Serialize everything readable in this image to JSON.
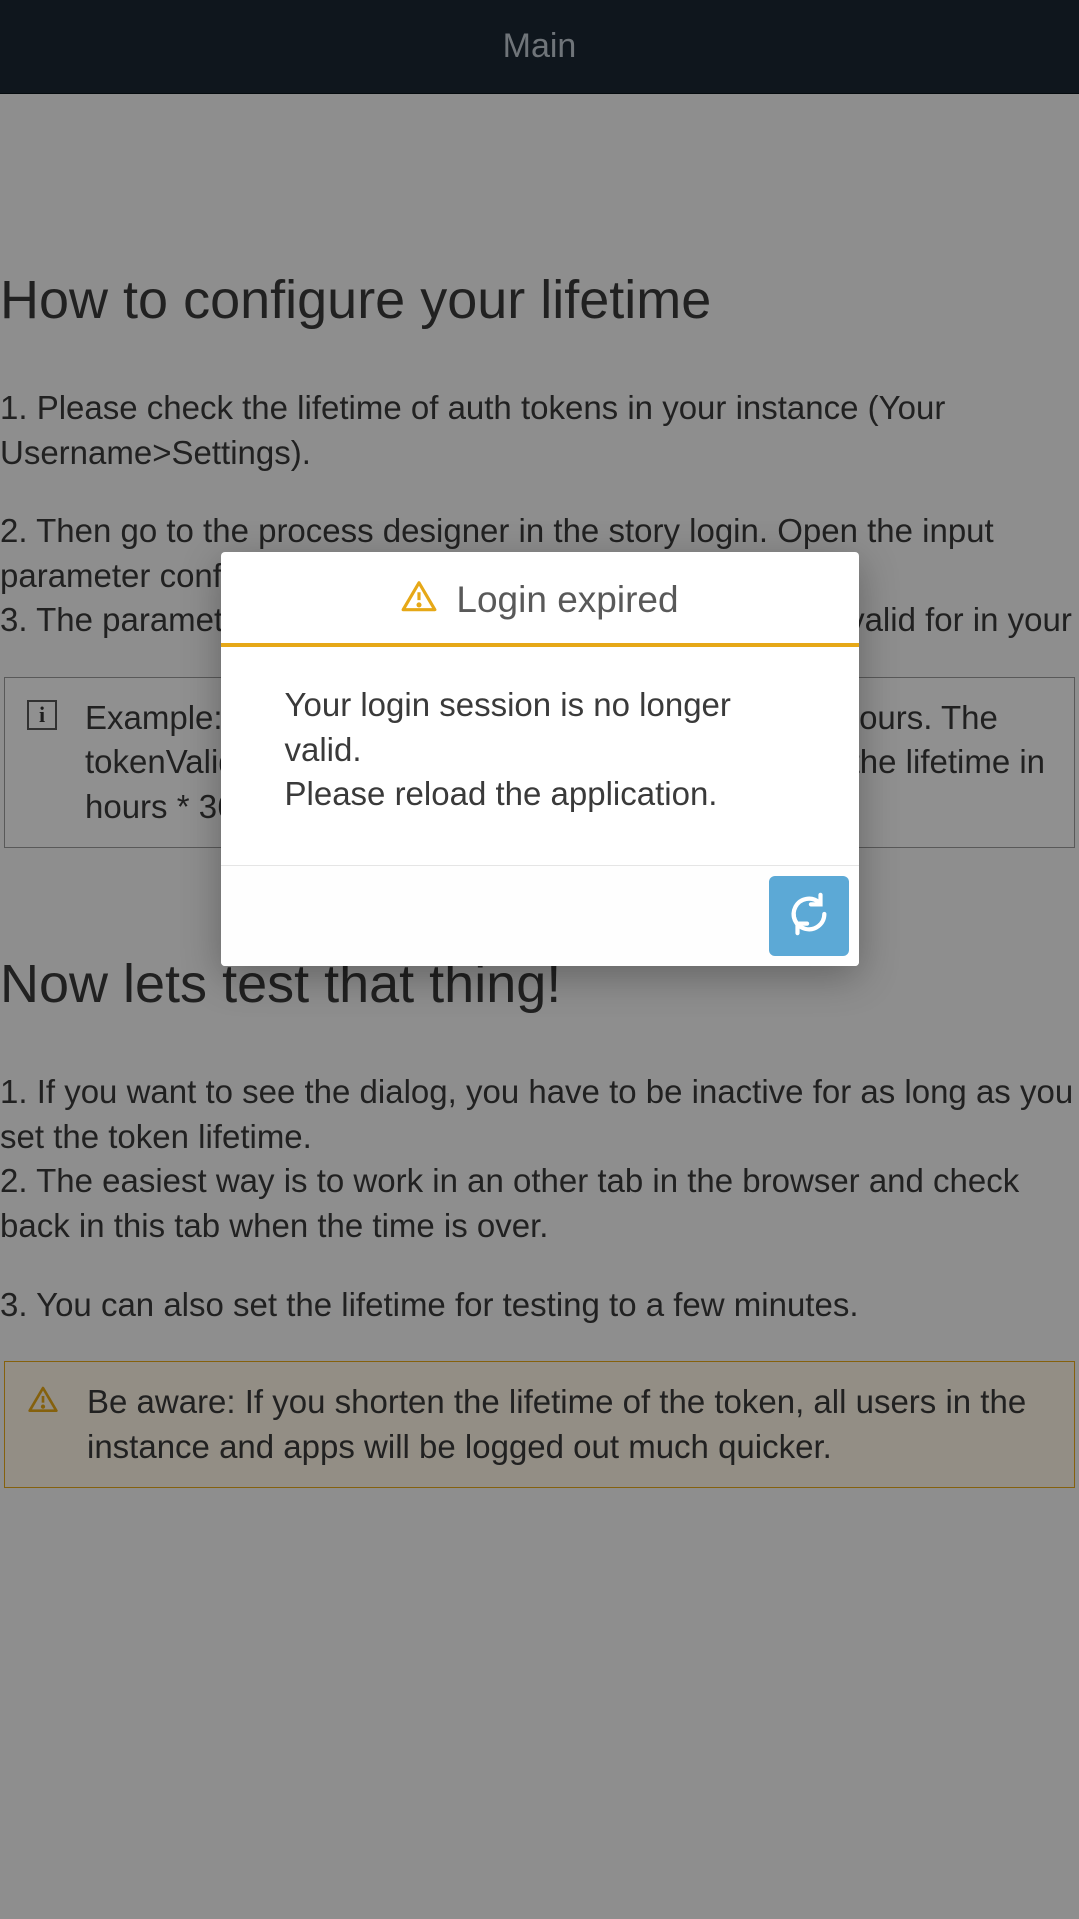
{
  "header": {
    "title": "Main"
  },
  "content": {
    "section1": {
      "heading": "How to configure your lifetime",
      "para1": "1. Please check the lifetime of auth tokens in your instance (Your Username>Settings).",
      "para2a": "2. Then go to the process designer in the story login. Open the input parameter configuration of the CBO ITIZ_Utilities.",
      "para2b": "3. The parameter tokenValidFor needs the time a token is valid for in your ",
      "infobox": "Example: If your instance has a token lifetime of 12 hours. The tokenValidFor needs to be 43200. The calculation is the lifetime in hours * 3600."
    },
    "section2": {
      "heading": "Now lets test that thing!",
      "para1a": "1. If you want to see the dialog, you have to be inactive for as long as you set the token lifetime.",
      "para1b": "2. The easiest way is to work in an other tab in the browser and check back in this tab when the time is over.",
      "para2": "3. You can also set the lifetime for testing to a few minutes.",
      "warning": "Be aware: If you shorten the lifetime of the token, all users in the instance and apps will be logged out much quicker."
    }
  },
  "dialog": {
    "title": "Login expired",
    "body_line1": "Your login session is no longer valid.",
    "body_line2": "Please reload the application."
  }
}
